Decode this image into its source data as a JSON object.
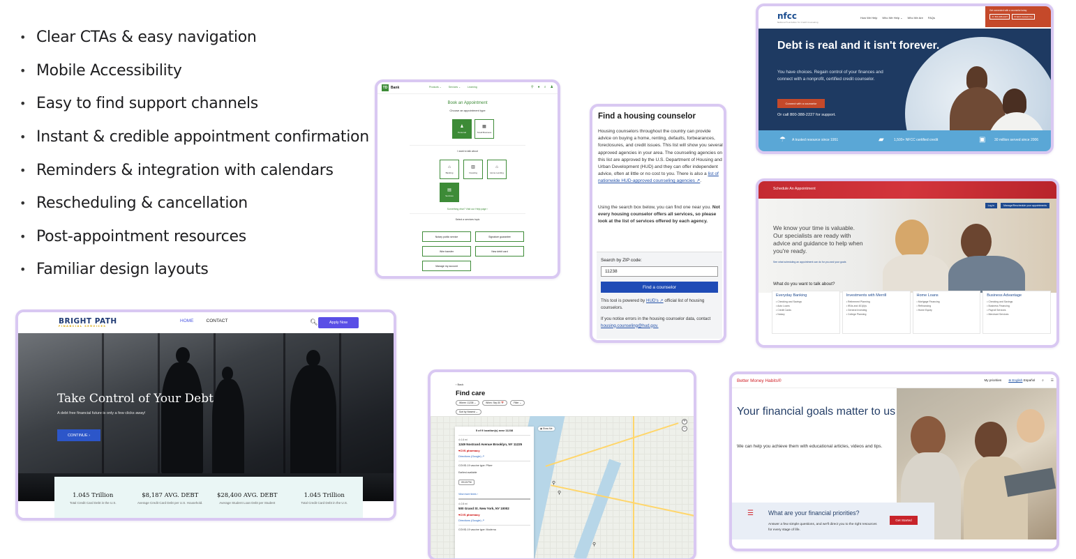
{
  "bullets": [
    "Clear CTAs & easy navigation",
    "Mobile Accessibility",
    "Easy to find support channels",
    "Instant & credible appointment confirmation",
    "Reminders & integration with calendars",
    "Rescheduling & cancellation",
    "Post-appointment resources",
    "Familiar design layouts"
  ],
  "bright_path": {
    "logo": "BRIGHT PATH",
    "logo_sub": "FINANCIAL SERVICES",
    "nav_home": "HOME",
    "nav_contact": "CONTACT",
    "apply": "Apply Now",
    "title": "Take Control of Your Debt",
    "subtitle": "A debt free financial future is only a few clicks away!",
    "cta": "CONTINUE ›",
    "stats": [
      {
        "value": "1.045 Trillion",
        "label": "Total Credit Card Debt in the U.S."
      },
      {
        "value": "$8,187 AVG. DEBT",
        "label": "Average Credit Card Debt per U.S. Household."
      },
      {
        "value": "$28,400 AVG. DEBT",
        "label": "Average Student Loan Debt per Student"
      },
      {
        "value": "1.045 Trillion",
        "label": "Total Credit Card Debt in the U.S."
      }
    ]
  },
  "td_bank": {
    "logo": "TD",
    "name": "Bank",
    "links": [
      "Products ⌄",
      "Services ⌄",
      "Learning"
    ],
    "heading": "Book an Appointment",
    "choose": "Choose an appointment type",
    "types": [
      "Personal",
      "Small Business"
    ],
    "talk": "I want to talk about",
    "topics": [
      "Banking",
      "Investing",
      "Home Lending",
      "Services"
    ],
    "else_link": "Something else? Visit our Help page ›",
    "select": "Select a services topic",
    "services": [
      "Notary public service",
      "Signature guarantee",
      "Wire transfer",
      "New debit card",
      "Manage my account"
    ]
  },
  "housing": {
    "title": "Find a housing counselor",
    "para1": "Housing counselors throughout the country can provide advice on buying a home, renting, defaults, forbearances, foreclosures, and credit issues. This list will show you several approved agencies in your area. The counseling agencies on this list are approved by the U.S. Department of Housing and Urban Development (HUD) and they can offer independent advice, often at little or no cost to you. There is also a",
    "para1_link": "list of nationwide HUD-approved counseling agencies ↗",
    "para2_start": "Using the search box below, you can find one near you.",
    "para2_bold": "Not every housing counselor offers all services, so please look at the list of services offered by each agency.",
    "zip_label": "Search by ZIP code:",
    "zip_value": "11238",
    "find_button": "Find a counselor",
    "note1_start": "This tool is powered by",
    "note1_link": "HUD's ↗",
    "note1_end": "official list of housing counselors.",
    "note2_start": "If you notice errors in the housing counselor data, contact",
    "note2_link": "housing.counseling@hud.gov."
  },
  "nfcc": {
    "logo": "nfcc",
    "logo_sub": "National Foundation for Credit Counseling",
    "links": [
      "How We Help",
      "Who We Help ⌄",
      "Who We Are",
      "FAQs"
    ],
    "help_text": "Get connected with a counselor today",
    "help_phone": "☏ 800-388-2227",
    "help_contact": "✉ We'll Contact You",
    "title": "Debt is real and it isn't forever.",
    "body": "You have choices. Regain control of your finances and connect with a nonprofit, certified credit counselor.",
    "button": "Connect with a counselor",
    "call": "Or call 800-388-2227 for support.",
    "band": [
      "A trusted resource since 1951",
      "1,500+ NFCC certified credit",
      "30 million served since 2006"
    ]
  },
  "schedule": {
    "bar": "Schedule An Appointment",
    "login": "Log in",
    "manage": "Manage/Reschedule your appointments",
    "intro": "We know your time is valuable. Our specialists are ready with advice and guidance to help when you're ready.",
    "link": "See what scheduling an appointment can do for you and your goals",
    "question": "What do you want to talk about?",
    "columns": [
      {
        "title": "Everyday Banking",
        "items": [
          "• Checking and Savings",
          "• Auto Loans",
          "• Credit Cards",
          "• Notary"
        ]
      },
      {
        "title": "Investments with Merrill",
        "items": [
          "• Retirement Planning",
          "• IRAs and 401(k)s",
          "• General Investing",
          "• College Planning"
        ]
      },
      {
        "title": "Home Loans",
        "items": [
          "• Mortgage Financing",
          "• Refinancing",
          "• Home Equity"
        ]
      },
      {
        "title": "Business Advantage",
        "items": [
          "• Checking and Savings",
          "• Business Financing",
          "• Payroll Services",
          "• Merchant Services"
        ]
      }
    ]
  },
  "findcare": {
    "back": "‹ Back",
    "title": "Find care",
    "filters": [
      "Where: 11238 ⌄",
      "When: Sep 30 📅",
      "Filter ⌄"
    ],
    "sort": "Sort by Nearest ⌄",
    "count": "5 of 9 location(s) near 11238",
    "results": [
      {
        "dist": "⊙ 1.6 mi",
        "addr": "1249 Nostrand Avenue Brooklyn, NY 11225",
        "pharmacy": "♥CVS pharmacy",
        "dir": "Directions (Google) ↗",
        "vax": "COVID-19 vaccine type: Pfizer",
        "earliest": "Earliest available",
        "slot": "09:15 PM",
        "more": "View more times ›"
      },
      {
        "dist": "⊙ 2.8 mi",
        "addr": "500 Grand St. New York, NY 10002",
        "pharmacy": "♥CVS pharmacy",
        "dir": "Directions (Google) ↗",
        "vax": "COVID-19 vaccine type: Moderna"
      }
    ],
    "show_me": "◉ Show Me"
  },
  "bmh": {
    "logo": "Better Money Habits®",
    "priorities": "My priorities",
    "english": "⊕ English",
    "espanol": "Español",
    "title": "Your financial goals matter to us",
    "body": "We can help you achieve them with educational articles, videos and tips.",
    "question": "What are your financial priorities?",
    "question_sub": "Answer a few simple questions, and we'll direct you to the right resources for every stage of life.",
    "button": "Get Started"
  }
}
